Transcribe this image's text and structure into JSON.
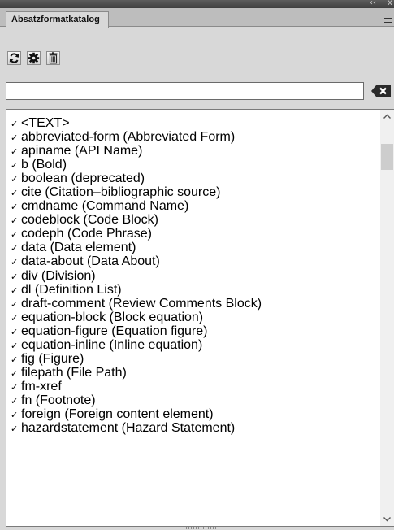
{
  "window": {
    "collapse_glyph": "‹‹",
    "close_glyph": "x"
  },
  "panel": {
    "tab_label": "Absatzformatkatalog"
  },
  "toolbar": {
    "icons": [
      "refresh-icon",
      "gear-icon",
      "delete-unused-icon"
    ]
  },
  "search": {
    "value": "",
    "placeholder": ""
  },
  "list": {
    "check_glyph": "✓",
    "items": [
      "<TEXT>",
      "abbreviated-form  (Abbreviated Form)",
      "apiname  (API Name)",
      "b  (Bold)",
      "boolean  (deprecated)",
      "cite  (Citation–bibliographic source)",
      "cmdname  (Command Name)",
      "codeblock  (Code Block)",
      "codeph  (Code Phrase)",
      "data  (Data element)",
      "data-about  (Data About)",
      "div  (Division)",
      "dl  (Definition List)",
      "draft-comment  (Review Comments Block)",
      "equation-block  (Block equation)",
      "equation-figure  (Equation figure)",
      "equation-inline  (Inline equation)",
      "fig  (Figure)",
      "filepath  (File Path)",
      "fm-xref",
      "fn  (Footnote)",
      "foreign  (Foreign content element)",
      "hazardstatement  (Hazard Statement)"
    ]
  }
}
